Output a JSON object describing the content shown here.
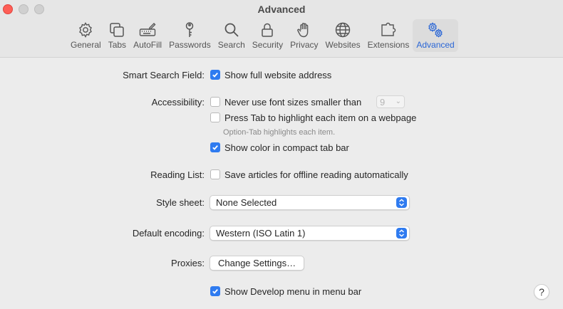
{
  "window": {
    "title": "Advanced"
  },
  "toolbar": {
    "items": [
      {
        "label": "General",
        "icon": "gear-icon",
        "active": false
      },
      {
        "label": "Tabs",
        "icon": "tabs-icon",
        "active": false
      },
      {
        "label": "AutoFill",
        "icon": "keyboard-pen-icon",
        "active": false
      },
      {
        "label": "Passwords",
        "icon": "key-icon",
        "active": false
      },
      {
        "label": "Search",
        "icon": "magnifier-icon",
        "active": false
      },
      {
        "label": "Security",
        "icon": "lock-icon",
        "active": false
      },
      {
        "label": "Privacy",
        "icon": "hand-icon",
        "active": false
      },
      {
        "label": "Websites",
        "icon": "globe-icon",
        "active": false
      },
      {
        "label": "Extensions",
        "icon": "puzzle-icon",
        "active": false
      },
      {
        "label": "Advanced",
        "icon": "gears-icon",
        "active": true
      }
    ]
  },
  "settings": {
    "smart_search": {
      "label": "Smart Search Field:",
      "option": "Show full website address",
      "checked": true
    },
    "accessibility": {
      "label": "Accessibility:",
      "font_size_option": "Never use font sizes smaller than",
      "font_size_checked": false,
      "font_size_value": "9",
      "tab_option": "Press Tab to highlight each item on a webpage",
      "tab_checked": false,
      "tab_hint": "Option-Tab highlights each item.",
      "compact_option": "Show color in compact tab bar",
      "compact_checked": true
    },
    "reading_list": {
      "label": "Reading List:",
      "option": "Save articles for offline reading automatically",
      "checked": false
    },
    "style_sheet": {
      "label": "Style sheet:",
      "value": "None Selected"
    },
    "encoding": {
      "label": "Default encoding:",
      "value": "Western (ISO Latin 1)"
    },
    "proxies": {
      "label": "Proxies:",
      "button": "Change Settings…"
    },
    "develop": {
      "option": "Show Develop menu in menu bar",
      "checked": true
    }
  },
  "help": {
    "label": "?"
  },
  "colors": {
    "accent": "#2f7bf0",
    "active_tab_text": "#2a66d6",
    "background": "#ececec"
  }
}
